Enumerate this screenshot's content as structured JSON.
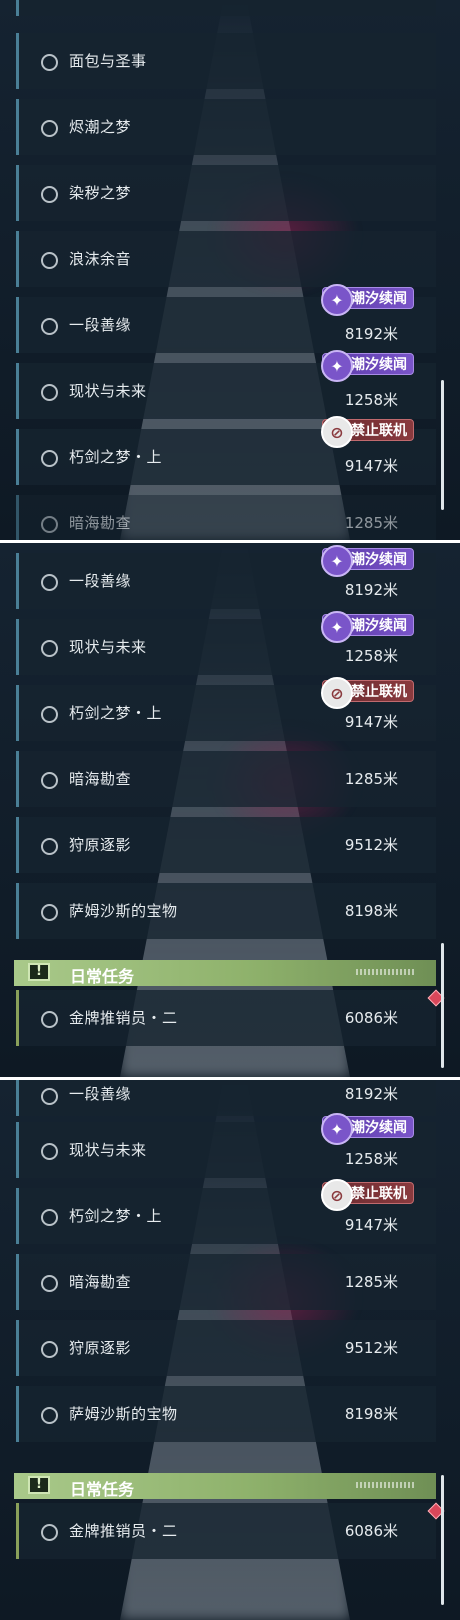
{
  "badges": {
    "tide": "潮汐续闻",
    "no_online": "禁止联机"
  },
  "section": {
    "daily": "日常任务",
    "icon": "!"
  },
  "unit": "米",
  "panel1": {
    "rows": [
      {
        "name": "面包与圣事",
        "dist": ""
      },
      {
        "name": "烬潮之梦",
        "dist": ""
      },
      {
        "name": "染秽之梦",
        "dist": ""
      },
      {
        "name": "浪沫余音",
        "dist": ""
      },
      {
        "name": "一段善缘",
        "dist": "8192米",
        "badge": "tide"
      },
      {
        "name": "现状与未来",
        "dist": "1258米",
        "badge": "tide"
      },
      {
        "name": "朽剑之梦・上",
        "dist": "9147米",
        "badge": "no_online"
      },
      {
        "name": "暗海勘查",
        "dist": "1285米"
      }
    ]
  },
  "panel2": {
    "rows": [
      {
        "name": "一段善缘",
        "dist": "8192米",
        "badge": "tide"
      },
      {
        "name": "现状与未来",
        "dist": "1258米",
        "badge": "tide"
      },
      {
        "name": "朽剑之梦・上",
        "dist": "9147米",
        "badge": "no_online"
      },
      {
        "name": "暗海勘查",
        "dist": "1285米"
      },
      {
        "name": "狩原逐影",
        "dist": "9512米"
      },
      {
        "name": "萨姆沙斯的宝物",
        "dist": "8198米"
      }
    ],
    "daily": [
      {
        "name": "金牌推销员・二",
        "dist": "6086米"
      }
    ]
  },
  "panel3": {
    "rows": [
      {
        "name": "一段善缘",
        "dist": "8192米"
      },
      {
        "name": "现状与未来",
        "dist": "1258米",
        "badge": "tide"
      },
      {
        "name": "朽剑之梦・上",
        "dist": "9147米",
        "badge": "no_online"
      },
      {
        "name": "暗海勘查",
        "dist": "1285米"
      },
      {
        "name": "狩原逐影",
        "dist": "9512米"
      },
      {
        "name": "萨姆沙斯的宝物",
        "dist": "8198米"
      }
    ],
    "daily": [
      {
        "name": "金牌推销员・二",
        "dist": "6086米"
      }
    ]
  }
}
